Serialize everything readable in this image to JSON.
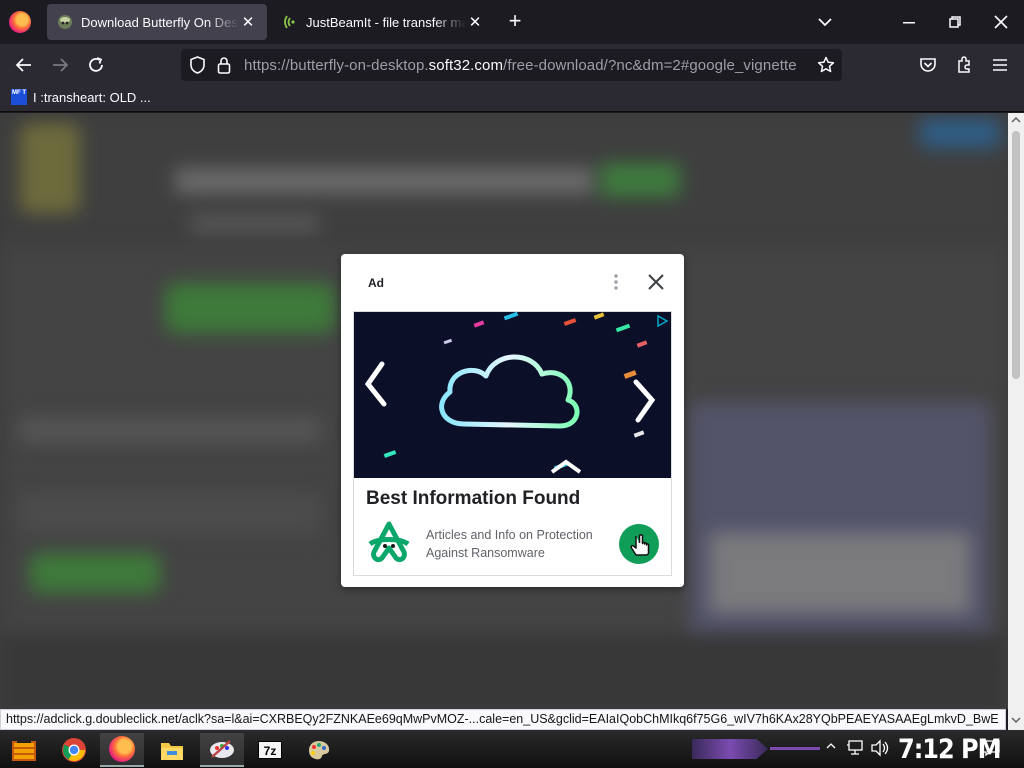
{
  "browser": {
    "tabs": [
      {
        "title": "Download Butterfly On Desktop",
        "active": true
      },
      {
        "title": "JustBeamIt - file transfer made easy",
        "active": false
      }
    ],
    "url": {
      "prefix": "https://butterfly-on-desktop.",
      "host": "soft32.com",
      "suffix": "/free-download/?nc&dm=2#google_vignette"
    },
    "bookmarks": [
      {
        "label": "I :transheart: OLD ...",
        "icon_text": "MF T"
      }
    ]
  },
  "ad": {
    "label": "Ad",
    "headline": "Best Information Found",
    "description": "Articles and Info on Protection Against Ransomware"
  },
  "status_url": "https://adclick.g.doubleclick.net/aclk?sa=l&ai=CXRBEQy2FZNKAEe69qMwPvMOZ-...cale=en_US&gclid=EAIaIQobChMIkq6f75G6_wIV7h6KAx28YQbPEAEYASAAEgLmkvD_BwE",
  "taskbar": {
    "clock": "7:12 PM",
    "apps": [
      "start-icon",
      "chrome-icon",
      "firefox-icon",
      "file-explorer-icon",
      "paint-app-icon",
      "7zip-icon",
      "palette-icon"
    ]
  },
  "colors": {
    "firefox_dark": "#1c1b22",
    "firefox_toolbar": "#2b2a33",
    "ad_cta_green": "#0f9d58",
    "ad_logo_green": "#0aa66a"
  }
}
